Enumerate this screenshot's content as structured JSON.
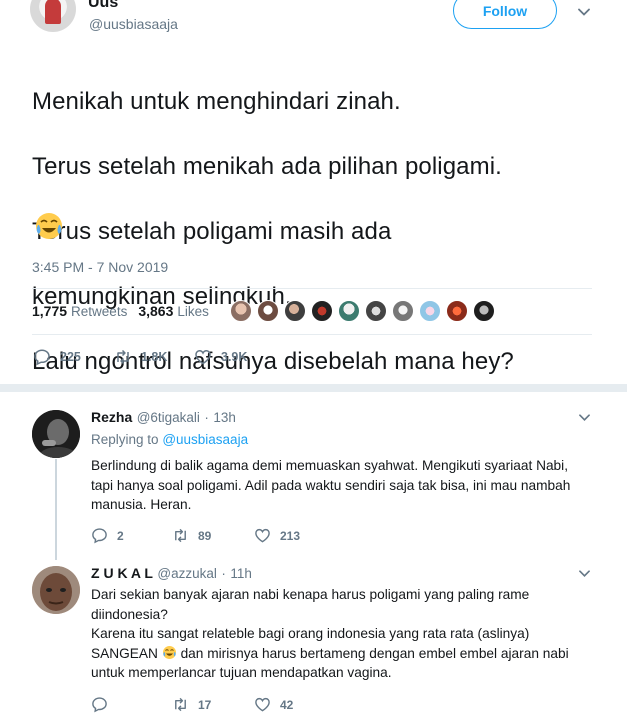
{
  "tweet": {
    "author_name": "Uus",
    "author_handle": "@uusbiasaaja",
    "follow_label": "Follow",
    "text_lines": [
      "Menikah untuk menghindari zinah.",
      "Terus setelah menikah ada pilihan poligami.",
      "Terus setelah poligami masih ada",
      "kemungkinan selingkuh.",
      "Lalu ngontrol nafsunya disebelah mana hey?"
    ],
    "emoji": "face-with-tears-of-joy",
    "timestamp": "3:45 PM - 7 Nov 2019",
    "retweets_count": "1,775",
    "retweets_label": "Retweets",
    "likes_count": "3,863",
    "likes_label": "Likes",
    "reply_count": "225",
    "retweet_count_short": "1.8K",
    "like_count_short": "3.9K"
  },
  "replies": [
    {
      "name": "Rezha",
      "handle": "@6tigakali",
      "time": "13h",
      "replying_prefix": "Replying to",
      "replying_to": "@uusbiasaaja",
      "text_lines": [
        "Berlindung di balik agama demi memuaskan syahwat. Mengikuti syariaat Nabi,",
        "tapi hanya soal poligami. Adil pada waktu sendiri saja tak bisa, ini mau nambah",
        "manusia. Heran."
      ],
      "reply_count": "2",
      "retweet_count": "89",
      "like_count": "213"
    },
    {
      "name": "Z U K A L",
      "handle": "@azzukal",
      "time": "11h",
      "text_lines": [
        "Dari sekian banyak ajaran nabi kenapa harus poligami yang paling rame",
        "diindonesia?",
        "Karena itu sangat relateble bagi orang indonesia yang rata rata (aslinya)"
      ],
      "line4_before": "SANGEAN",
      "line4_after": " dan mirisnya harus bertameng dengan embel embel ajaran nabi",
      "line5": "untuk memperlancar tujuan mendapatkan vagina.",
      "retweet_count": "17",
      "like_count": "42"
    }
  ],
  "colors": {
    "accent": "#1da1f2",
    "secondary_text": "#657786",
    "divider": "#e6ecf0",
    "like_red": "#e0245e"
  }
}
